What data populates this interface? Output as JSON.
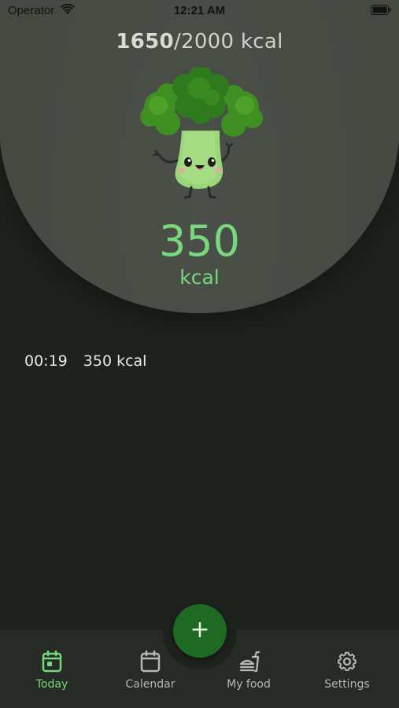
{
  "status_bar": {
    "operator": "Operator",
    "time": "12:21 AM"
  },
  "summary": {
    "consumed": "1650",
    "goal_suffix": "/2000 kcal",
    "remaining_value": "350",
    "remaining_unit": "kcal"
  },
  "entries": [
    {
      "time": "00:19",
      "amount": "350 kcal"
    }
  ],
  "fab": {
    "label": "+"
  },
  "tabs": [
    {
      "label": "Today",
      "icon": "today-calendar-icon",
      "active": true
    },
    {
      "label": "Calendar",
      "icon": "calendar-icon",
      "active": false
    },
    {
      "label": "My food",
      "icon": "food-icon",
      "active": false
    },
    {
      "label": "Settings",
      "icon": "gear-icon",
      "active": false
    }
  ],
  "colors": {
    "accent": "#78d87c",
    "fab": "#1f6a22",
    "dome": "#464b44",
    "background": "#1e211e",
    "tab_bar": "#262b25"
  }
}
